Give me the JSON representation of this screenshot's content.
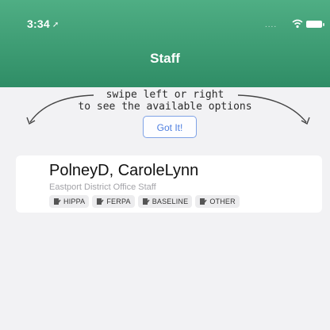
{
  "status_bar": {
    "time": "3:34",
    "signal": "....",
    "icons": [
      "location-arrow-icon",
      "wifi-icon",
      "battery-icon"
    ]
  },
  "header": {
    "title": "Staff"
  },
  "hint": {
    "line1": "swipe left or right",
    "line2": "to see the available options",
    "button_label": "Got It!"
  },
  "staff_list": {
    "items": [
      {
        "name": "PolneyD, CaroleLynn",
        "subtitle": "Eastport District Office Staff",
        "tags": [
          {
            "label": "HIPPA",
            "icon": "document-pen-icon"
          },
          {
            "label": "FERPA",
            "icon": "document-pen-icon"
          },
          {
            "label": "BASELINE",
            "icon": "document-pen-icon"
          },
          {
            "label": "OTHER",
            "icon": "document-pen-icon"
          }
        ]
      }
    ]
  },
  "colors": {
    "header_top": "#4fae84",
    "header_bottom": "#2f8d66",
    "button_accent": "#4f7fe0",
    "background": "#f2f2f4"
  }
}
